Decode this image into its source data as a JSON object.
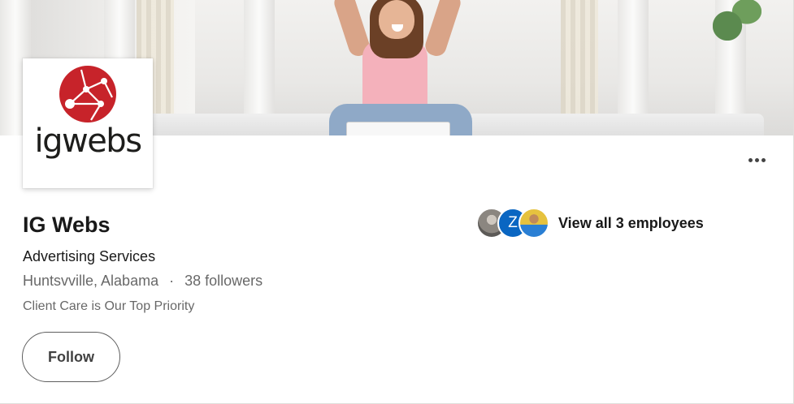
{
  "company": {
    "name": "IG Webs",
    "industry": "Advertising Services",
    "location": "Huntsvville, Alabama",
    "separator": "·",
    "followers": "38 followers",
    "tagline": "Client Care is Our Top Priority",
    "logo_wordmark": "igwebs"
  },
  "actions": {
    "follow_label": "Follow",
    "more_icon": "ellipsis-icon"
  },
  "employees": {
    "label": "View all 3 employees",
    "avatar_initial": "Z"
  },
  "colors": {
    "logo_red": "#c7232a",
    "avatar_blue": "#0a66c2"
  }
}
